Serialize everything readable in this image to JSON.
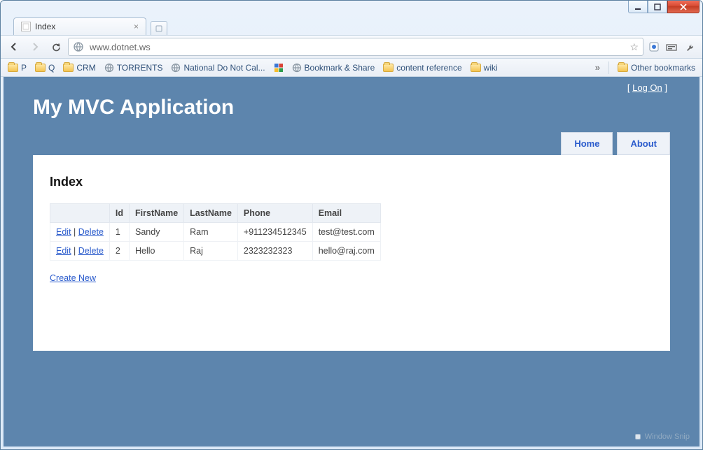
{
  "browser": {
    "tab_title": "Index",
    "url": "www.dotnet.ws"
  },
  "bookmarks": {
    "items": [
      {
        "label": "P",
        "kind": "folder"
      },
      {
        "label": "Q",
        "kind": "folder"
      },
      {
        "label": "CRM",
        "kind": "folder"
      },
      {
        "label": "TORRENTS",
        "kind": "globe"
      },
      {
        "label": "National Do Not Cal...",
        "kind": "globe"
      },
      {
        "label": "",
        "kind": "google"
      },
      {
        "label": "Bookmark & Share",
        "kind": "globe"
      },
      {
        "label": "content reference",
        "kind": "folder"
      },
      {
        "label": "wiki",
        "kind": "folder"
      }
    ],
    "other_label": "Other bookmarks"
  },
  "page": {
    "logon_prefix": "[ ",
    "logon_link": "Log On",
    "logon_suffix": " ]",
    "app_title": "My MVC Application",
    "nav": {
      "home": "Home",
      "about": "About"
    },
    "heading": "Index",
    "columns": [
      "",
      "Id",
      "FirstName",
      "LastName",
      "Phone",
      "Email"
    ],
    "actions": {
      "edit": "Edit",
      "delete": "Delete"
    },
    "rows": [
      {
        "id": "1",
        "first": "Sandy",
        "last": "Ram",
        "phone": "+911234512345",
        "email": "test@test.com"
      },
      {
        "id": "2",
        "first": "Hello",
        "last": "Raj",
        "phone": "2323232323",
        "email": "hello@raj.com"
      }
    ],
    "create": "Create New"
  },
  "watermark": "Window Snip"
}
